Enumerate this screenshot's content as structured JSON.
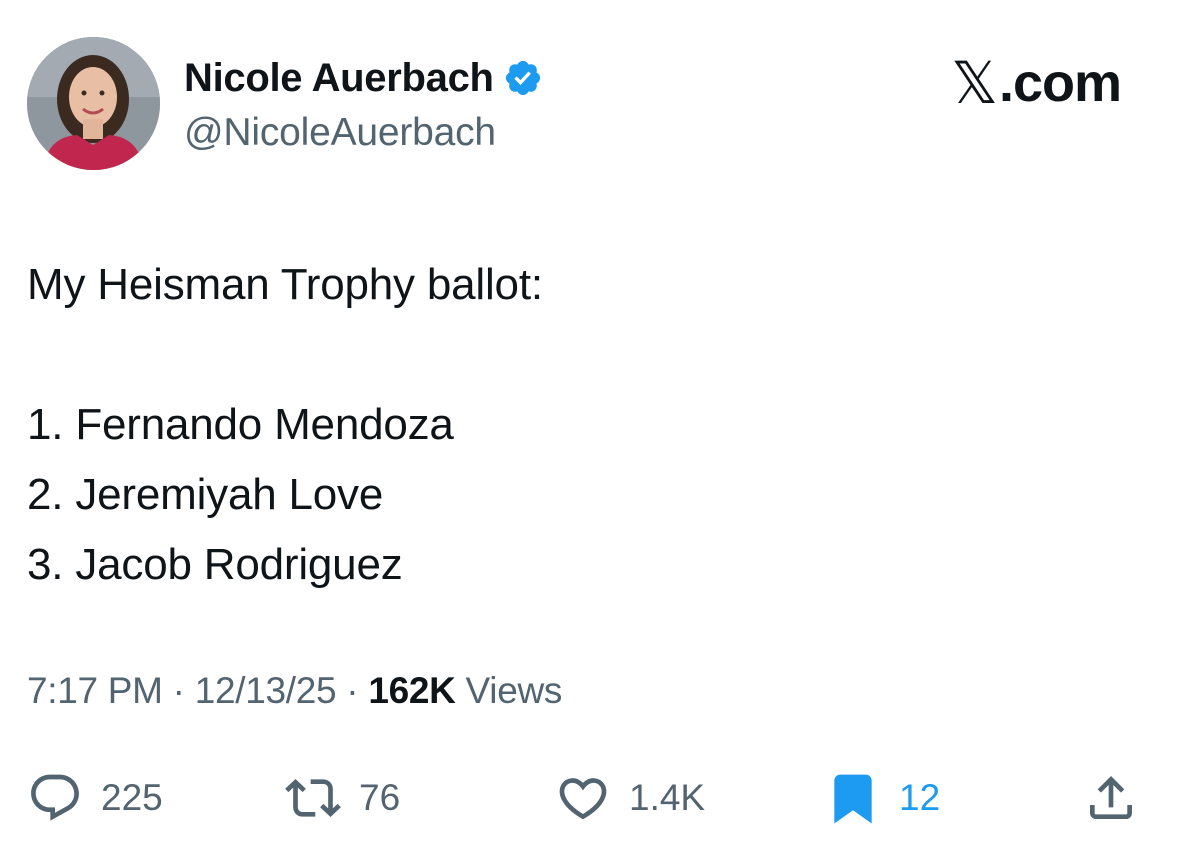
{
  "author": {
    "display_name": "Nicole Auerbach",
    "handle": "@NicoleAuerbach",
    "verified_icon": "verified-badge-icon"
  },
  "brand": {
    "domain": ".com",
    "logo_icon": "x-logo-icon"
  },
  "tweet": {
    "lines": [
      "My Heisman Trophy ballot:",
      "",
      "1. Fernando Mendoza",
      "2. Jeremiyah Love",
      "3. Jacob Rodriguez"
    ]
  },
  "meta": {
    "time": "7:17 PM",
    "separator": " · ",
    "date": "12/13/25",
    "views_count": "162K",
    "views_label": " Views"
  },
  "actions": {
    "replies": "225",
    "reposts": "76",
    "likes": "1.4K",
    "bookmarks": "12"
  },
  "colors": {
    "text": "#0f1419",
    "secondary": "#536471",
    "accent": "#1d9bf0"
  }
}
